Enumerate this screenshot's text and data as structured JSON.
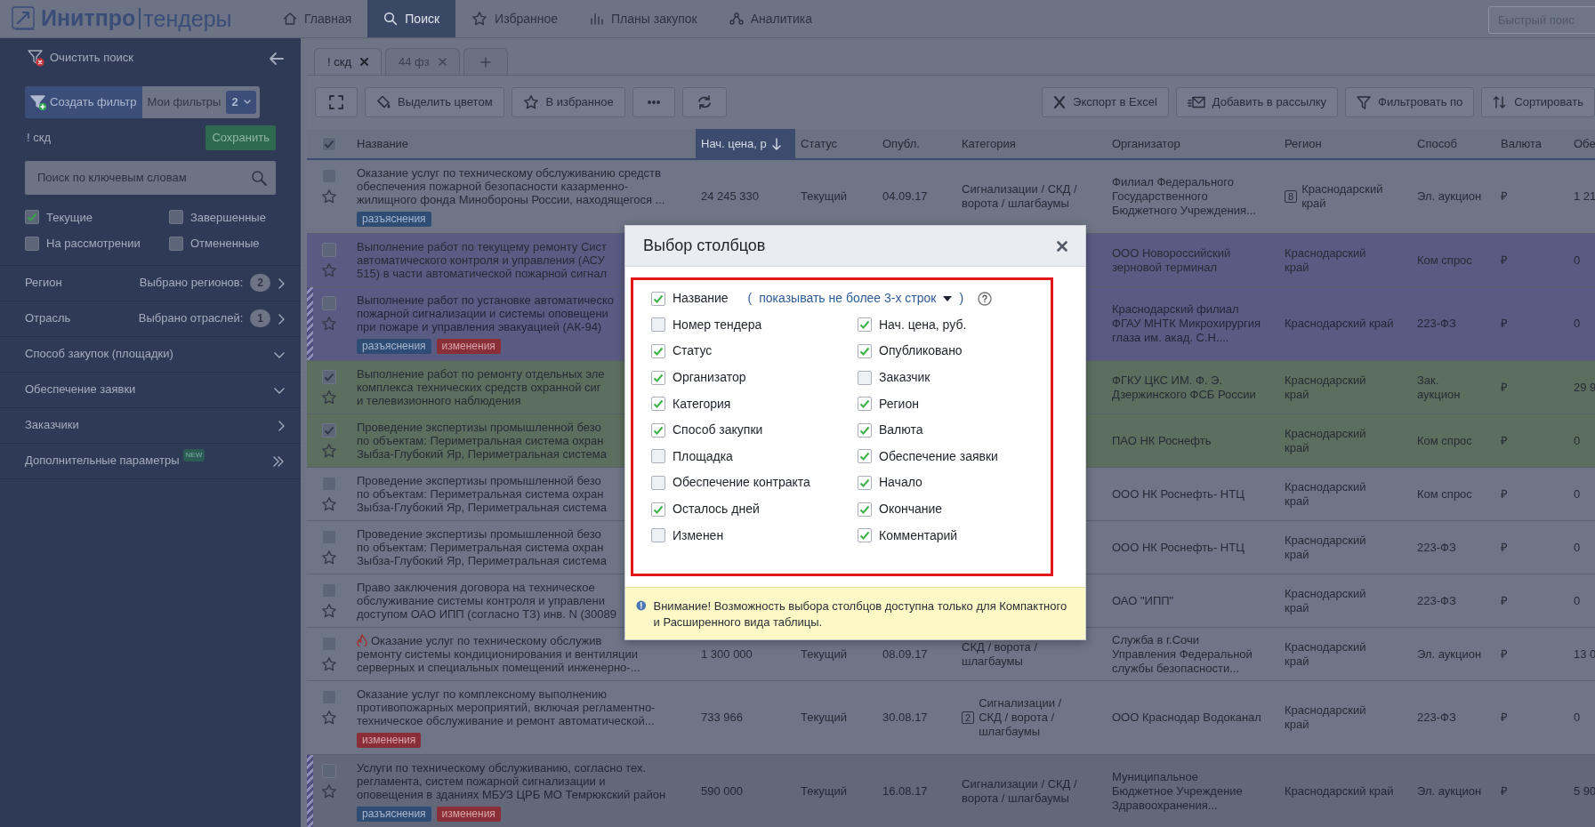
{
  "nav": {
    "brand": "Инитпро",
    "product": "тендеры",
    "items": [
      {
        "label": "Главная",
        "kind": "home",
        "selected": false
      },
      {
        "label": "Поиск",
        "kind": "search",
        "selected": true
      },
      {
        "label": "Избранное",
        "kind": "favorites",
        "selected": false
      },
      {
        "label": "Планы закупок",
        "kind": "plans",
        "selected": false
      },
      {
        "label": "Аналитика",
        "kind": "analytics",
        "selected": false
      }
    ],
    "quick_search": {
      "placeholder": "Быстрый поис"
    }
  },
  "sidebar": {
    "clear": "Очистить поиск",
    "create_filter": "Создать фильтр",
    "my_filters": "Мои фильтры",
    "filters_count": "2",
    "filter_name": "! скд",
    "save": "Сохранить",
    "search": {
      "placeholder": "Поиск по ключевым словам"
    },
    "statuses": [
      {
        "label": "Текущие",
        "checked": true
      },
      {
        "label": "Завершенные",
        "checked": false
      },
      {
        "label": "На рассмотрении",
        "checked": false
      },
      {
        "label": "Отмененные",
        "checked": false
      }
    ],
    "sections": [
      {
        "label": "Регион",
        "summary": "Выбрано регионов:",
        "count": "2",
        "kind": "link"
      },
      {
        "label": "Отрасль",
        "summary": "Выбрано отраслей:",
        "count": "1",
        "kind": "link"
      },
      {
        "label": "Способ закупок (площадки)",
        "kind": "dropdown"
      },
      {
        "label": "Обеспечение заявки",
        "kind": "dropdown"
      },
      {
        "label": "Заказчики",
        "kind": "link"
      },
      {
        "label": "Дополнительные параметры",
        "badge": "NEW",
        "kind": "more"
      }
    ]
  },
  "tabs": [
    {
      "label": "! скд",
      "selected": true
    },
    {
      "label": "44 фз",
      "selected": false
    }
  ],
  "toolbar": {
    "left": [
      {
        "kind": "fullscreen"
      },
      {
        "kind": "color",
        "label": "Выделить цветом"
      },
      {
        "kind": "favorite",
        "label": "В избранное"
      },
      {
        "kind": "more"
      },
      {
        "kind": "refresh"
      }
    ],
    "right": [
      {
        "kind": "excel",
        "label": "Экспорт в Excel"
      },
      {
        "kind": "mail",
        "label": "Добавить в рассылку"
      },
      {
        "kind": "filter",
        "label": "Фильтровать по"
      },
      {
        "kind": "sort",
        "label": "Сортировать"
      }
    ]
  },
  "table": {
    "all_checked": true,
    "columns": [
      {
        "label": "Название",
        "sorted": false
      },
      {
        "label": "Нач. цена, р",
        "sorted": true
      },
      {
        "label": "Статус",
        "sorted": false
      },
      {
        "label": "Опубл.",
        "sorted": false
      },
      {
        "label": "Категория",
        "sorted": false
      },
      {
        "label": "Организатор",
        "sorted": false
      },
      {
        "label": "Регион",
        "sorted": false
      },
      {
        "label": "Способ",
        "sorted": false
      },
      {
        "label": "Валюта",
        "sorted": false
      },
      {
        "label": "Обе",
        "sorted": false
      }
    ],
    "rows": [
      {
        "color": "#6e7586",
        "striped": false,
        "checked": false,
        "favorite": false,
        "hot": false,
        "title": "Оказание услуг по техническому обслуживанию средств\nобеспечения пожарной безопасности казарменно-\nжилищного фонда Минобороны России, находящегося ...",
        "tags": [
          {
            "kind": "clarification",
            "label": "разъяснения"
          }
        ],
        "price": "24 245 330",
        "status": "Текущий",
        "published": "04.09.17",
        "category": "Сигнализации / СКД /\nворота / шлагбаумы",
        "organizer": "Филиал Федерального\nГосударственного\nБюджетного Учреждения...",
        "region_count": "8",
        "region": "Краснодарский\nкрай",
        "method": "Эл. аукцион",
        "currency": "₽",
        "column_11": "1 21"
      },
      {
        "color": "#5a5b82",
        "striped": false,
        "checked": false,
        "favorite": false,
        "hot": false,
        "title": "Выполнение работ по текущему ремонту Сист\nавтоматического контроля и управления (АСУ\n515) в части автоматической пожарной сигнал",
        "tags": [],
        "organizer": "ООО Новороссийский\nзерновой терминал",
        "region": "Краснодарский\nкрай",
        "method": "Ком спрос",
        "currency": "₽",
        "column_11": "0"
      },
      {
        "color": "#5a5b82",
        "striped": true,
        "checked": false,
        "favorite": false,
        "hot": false,
        "title": "Выполнение работ по установке автоматическо\nпожарной сигнализации и системы оповещени\nпри пожаре и управления эвакуацией (АК-94)",
        "tags": [
          {
            "kind": "clarification",
            "label": "разъяснения"
          },
          {
            "kind": "changes",
            "label": "изменения"
          }
        ],
        "organizer": "Краснодарский филиал\nФГАУ МНТК Микрохирургия\nглаза им. акад. С.Н....",
        "region": "Краснодарский край",
        "method": "223-ФЗ",
        "currency": "₽",
        "column_11": "0"
      },
      {
        "color": "#5c6f5e",
        "striped": false,
        "checked": true,
        "favorite": false,
        "hot": false,
        "title": "Выполнение работ по ремонту отдельных эле\nкомплекса технических средств охранной сиг\nи телевизионного наблюдения",
        "tags": [],
        "organizer": "ФГКУ ЦКС ИМ. Ф. Э.\nДзержинского ФСБ России",
        "region": "Краснодарский\nкрай",
        "method": "Зак.\nаукцион",
        "currency": "₽",
        "column_11": "29 9"
      },
      {
        "color": "#5c6f5e",
        "striped": false,
        "checked": true,
        "favorite": false,
        "hot": false,
        "title": "Проведение экспертизы промышленной безо\nпо объектам: Периметральная система охран\nЗыбза-Глубокий Яр, Периметральная система",
        "tags": [],
        "organizer": "ПАО НК Роснефть",
        "region": "Краснодарский\nкрай",
        "method": "Ком спрос",
        "currency": "₽",
        "column_11": "0"
      },
      {
        "color": "#6e7586",
        "striped": false,
        "checked": false,
        "favorite": false,
        "hot": false,
        "title": "Проведение экспертизы промышленной безо\nпо объектам: Периметральная система охран\nЗыбза-Глубокий Яр, Периметральная система",
        "tags": [],
        "organizer": "ООО НК Роснефть- НТЦ",
        "region": "Краснодарский\nкрай",
        "method": "Ком спрос",
        "currency": "₽",
        "column_11": "0"
      },
      {
        "color": "#6e7586",
        "striped": false,
        "checked": false,
        "favorite": false,
        "hot": false,
        "title": "Проведение экспертизы промышленной безо\nпо объектам: Периметральная система охран\nЗыбза-Глубокий Яр, Периметральная система",
        "tags": [],
        "organizer": "ООО НК Роснефть- НТЦ",
        "region": "Краснодарский\nкрай",
        "method": "223-ФЗ",
        "currency": "₽",
        "column_11": "0"
      },
      {
        "color": "#6e7586",
        "striped": false,
        "checked": false,
        "favorite": false,
        "hot": false,
        "title": "Право заключения договора на техническое\nобслуживание системы контроля и управлени\nдоступом ОАО ИПП (согласно ТЗ) инв. N (30089",
        "tags": [],
        "organizer": "ОАО \"ИПП\"",
        "region": "Краснодарский\nкрай",
        "method": "223-ФЗ",
        "currency": "₽",
        "column_11": "0"
      },
      {
        "color": "#6e7586",
        "striped": false,
        "checked": false,
        "favorite": false,
        "hot": true,
        "title": "Оказание услуг по техническому обслужив\nремонту системы кондиционирования и вентиляции\nсерверных и специальных помещений инженерно-...",
        "tags": [],
        "price": "1 300 000",
        "status": "Текущий",
        "published": "08.09.17",
        "category": "СКД / ворота /\nшлагбаумы",
        "organizer": "Служба в г.Сочи\nУправления Федеральной\nслужбы безопасности...",
        "region": "Краснодарский\nкрай",
        "method": "Эл. аукцион",
        "currency": "₽",
        "column_11": "13 0"
      },
      {
        "color": "#6e7586",
        "striped": false,
        "checked": false,
        "favorite": false,
        "hot": false,
        "title": "Оказание услуг по комплексному выполнению\nпротивопожарных мероприятий, включая регламентно-\nтехническое обслуживание и ремонт автоматической...",
        "tags": [
          {
            "kind": "changes",
            "label": "изменения"
          }
        ],
        "price": "733 966",
        "status": "Текущий",
        "published": "30.08.17",
        "category_count": "2",
        "category": "Сигнализации /\nСКД / ворота /\nшлагбаумы",
        "organizer": "ООО Краснодар Водоканал",
        "region": "Краснодарский\nкрай",
        "method": "223-ФЗ",
        "currency": "₽",
        "column_11": "0"
      },
      {
        "color": "#626879",
        "striped": true,
        "checked": false,
        "favorite": false,
        "hot": false,
        "title": "Услуги по техническому обслуживанию, согласно тех.\nрегламента, систем пожарной сигнализации и\nоповещения в зданиях МБУЗ ЦРБ МО Темрюкский район",
        "tags": [
          {
            "kind": "clarification",
            "label": "разъяснения"
          },
          {
            "kind": "changes",
            "label": "изменения"
          }
        ],
        "price": "590 000",
        "status": "Текущий",
        "published": "16.08.17",
        "category": "Сигнализации / СКД /\nворота / шлагбаумы",
        "organizer": "Муниципальное\nБюджетное Учреждение\nЗдравоохранения...",
        "region": "Краснодарский край",
        "method": "Эл. аукцион",
        "currency": "₽",
        "column_11": "5 90"
      }
    ]
  },
  "modal": {
    "title": "Выбор столбцов",
    "name_option": {
      "label": "Название",
      "checked": true,
      "open": "(",
      "link": "показывать не более 3-х строк",
      "close": ")"
    },
    "options": [
      {
        "label": "Номер тендера",
        "checked": false
      },
      {
        "label": "Нач. цена, руб.",
        "checked": true
      },
      {
        "label": "Статус",
        "checked": true
      },
      {
        "label": "Опубликовано",
        "checked": true
      },
      {
        "label": "Организатор",
        "checked": true
      },
      {
        "label": "Заказчик",
        "checked": false
      },
      {
        "label": "Категория",
        "checked": true
      },
      {
        "label": "Регион",
        "checked": true
      },
      {
        "label": "Способ закупки",
        "checked": true
      },
      {
        "label": "Валюта",
        "checked": true
      },
      {
        "label": "Площадка",
        "checked": false
      },
      {
        "label": "Обеспечение заявки",
        "checked": true
      },
      {
        "label": "Обеспечение контракта",
        "checked": false
      },
      {
        "label": "Начало",
        "checked": true
      },
      {
        "label": "Осталось дней",
        "checked": true
      },
      {
        "label": "Окончание",
        "checked": true
      },
      {
        "label": "Изменен",
        "checked": false
      },
      {
        "label": "Комментарий",
        "checked": true
      }
    ],
    "warning": "Внимание! Возможность выбора столбцов доступна только для Компактного и Расширенного вида таблицы."
  }
}
